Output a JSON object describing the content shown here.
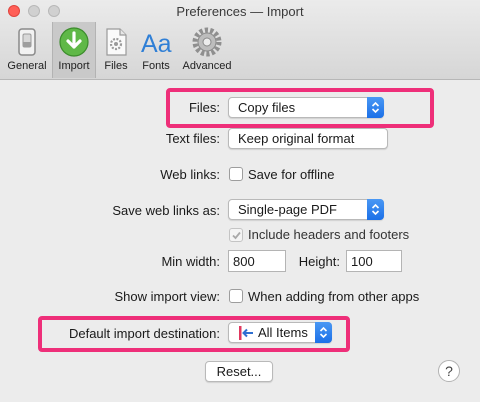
{
  "window": {
    "title": "Preferences — Import"
  },
  "toolbar": {
    "items": [
      {
        "label": "General",
        "icon": "switch-icon"
      },
      {
        "label": "Import",
        "icon": "download-arrow-icon",
        "selected": true
      },
      {
        "label": "Files",
        "icon": "gear-document-icon"
      },
      {
        "label": "Fonts",
        "icon": "aa-font-icon"
      },
      {
        "label": "Advanced",
        "icon": "gear-icon"
      }
    ]
  },
  "form": {
    "files": {
      "label": "Files:",
      "value": "Copy files"
    },
    "text_files": {
      "label": "Text files:",
      "value": "Keep original format"
    },
    "web_links": {
      "label": "Web links:",
      "checkbox_label": "Save for offline",
      "checked": false
    },
    "save_web_links_as": {
      "label": "Save web links as:",
      "value": "Single-page PDF"
    },
    "include_headers": {
      "checkbox_label": "Include headers and footers",
      "checked": true,
      "disabled": true
    },
    "min_width": {
      "label": "Min width:",
      "value": "800"
    },
    "height": {
      "label": "Height:",
      "value": "100"
    },
    "show_import_view": {
      "label": "Show import view:",
      "checkbox_label": "When adding from other apps",
      "checked": false
    },
    "default_import_destination": {
      "label": "Default import destination:",
      "value": "All Items",
      "icon": "inbox-arrow-icon"
    }
  },
  "buttons": {
    "reset": "Reset...",
    "help": "?"
  },
  "colors": {
    "highlight": "#ee2f79",
    "accent": "#1b70e8"
  }
}
